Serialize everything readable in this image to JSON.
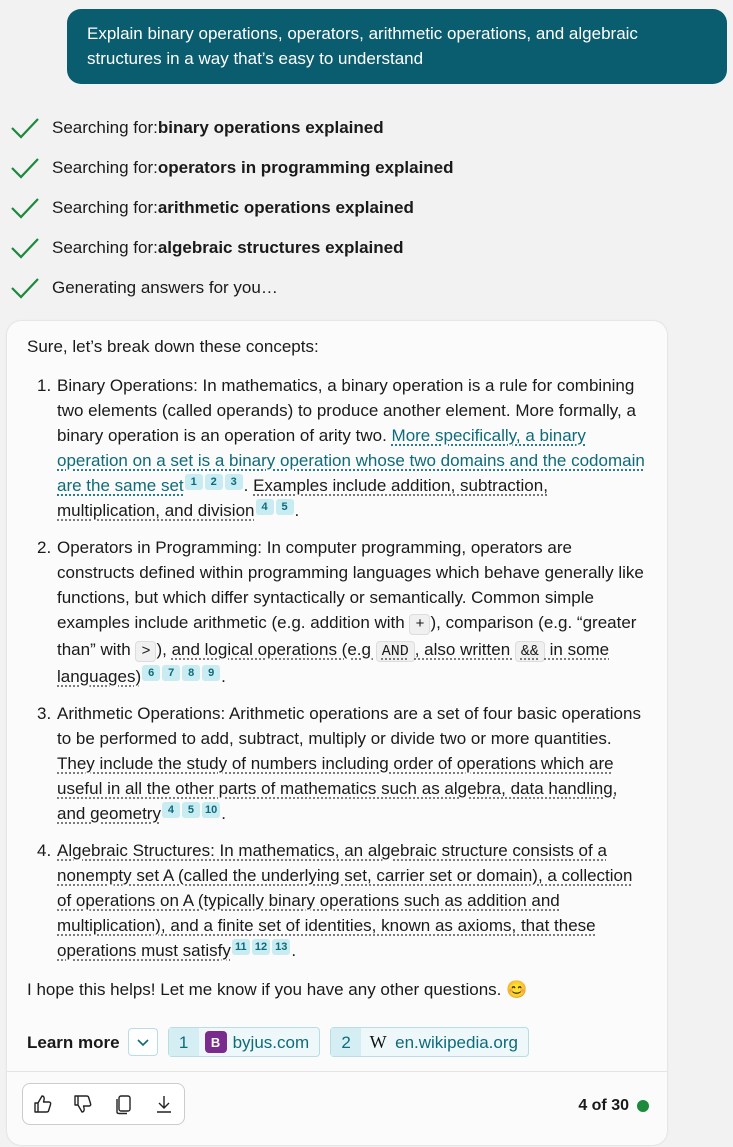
{
  "user_message": "Explain binary operations, operators, arithmetic operations, and algebraic structures in a way that’s easy to understand",
  "steps": [
    {
      "prefix": "Searching for: ",
      "query": "binary operations explained"
    },
    {
      "prefix": "Searching for: ",
      "query": "operators in programming explained"
    },
    {
      "prefix": "Searching for: ",
      "query": "arithmetic operations explained"
    },
    {
      "prefix": "Searching for: ",
      "query": "algebraic structures explained"
    },
    {
      "prefix": "Generating answers for you…",
      "query": ""
    }
  ],
  "answer": {
    "intro": "Sure, let’s break down these concepts:",
    "items": [
      {
        "num": "1.",
        "a": "Binary Operations: In mathematics, a binary operation is a rule for combining two elements (called operands) to produce another element. More formally, a binary operation is an operation of arity two. ",
        "cite": "More specifically, a binary operation on a set is a binary operation whose two domains and the codomain are the same set",
        "s1": "1",
        "s2": "2",
        "s3": "3",
        "b": ". ",
        "cite2": "Examples include addition, subtraction, multiplication, and division",
        "s4": "4",
        "s5": "5",
        "end": "."
      },
      {
        "num": "2.",
        "a": "Operators in Programming: In computer programming, operators are constructs defined within programming languages which behave generally like functions, but which differ syntactically or semantically. Common simple examples include arithmetic (e.g. addition with ",
        "code1": "+",
        "b": "), comparison (e.g. “greater than” with ",
        "code2": ">",
        "c": "), ",
        "cite": "and logical operations (e.g ",
        "code3": "AND",
        "d": ", also written ",
        "code4": "&&",
        "e": " in some languages)",
        "s1": "6",
        "s2": "7",
        "s3": "8",
        "s4": "9",
        "end": "."
      },
      {
        "num": "3.",
        "a": "Arithmetic Operations: Arithmetic operations are a set of four basic operations to be performed to add, subtract, multiply or divide two or more quantities. ",
        "cite": "They include the study of numbers including order of operations which are useful in all the other parts of mathematics such as algebra, data handling, and geometry",
        "s1": "4",
        "s2": "5",
        "s3": "10",
        "end": "."
      },
      {
        "num": "4.",
        "cite": "Algebraic Structures: In mathematics, an algebraic structure consists of a nonempty set A (called the underlying set, carrier set or domain), a collection of operations on A (typically binary operations such as addition and multiplication), and a finite set of identities, known as axioms, that these operations must satisfy",
        "s1": "11",
        "s2": "12",
        "s3": "13",
        "end": "."
      }
    ],
    "closing": "I hope this helps! Let me know if you have any other questions. 😊"
  },
  "learn_more": {
    "label": "Learn more",
    "sources": [
      {
        "index": "1",
        "domain": "byjus.com",
        "logo": "B"
      },
      {
        "index": "2",
        "domain": "en.wikipedia.org",
        "logo": "W"
      }
    ]
  },
  "pager": {
    "text": "4 of 30",
    "status_color": "#1c8a3c"
  },
  "colors": {
    "user_bubble": "#0a5d6e",
    "accent": "#0e6b7a",
    "check": "#1c8a3c"
  }
}
